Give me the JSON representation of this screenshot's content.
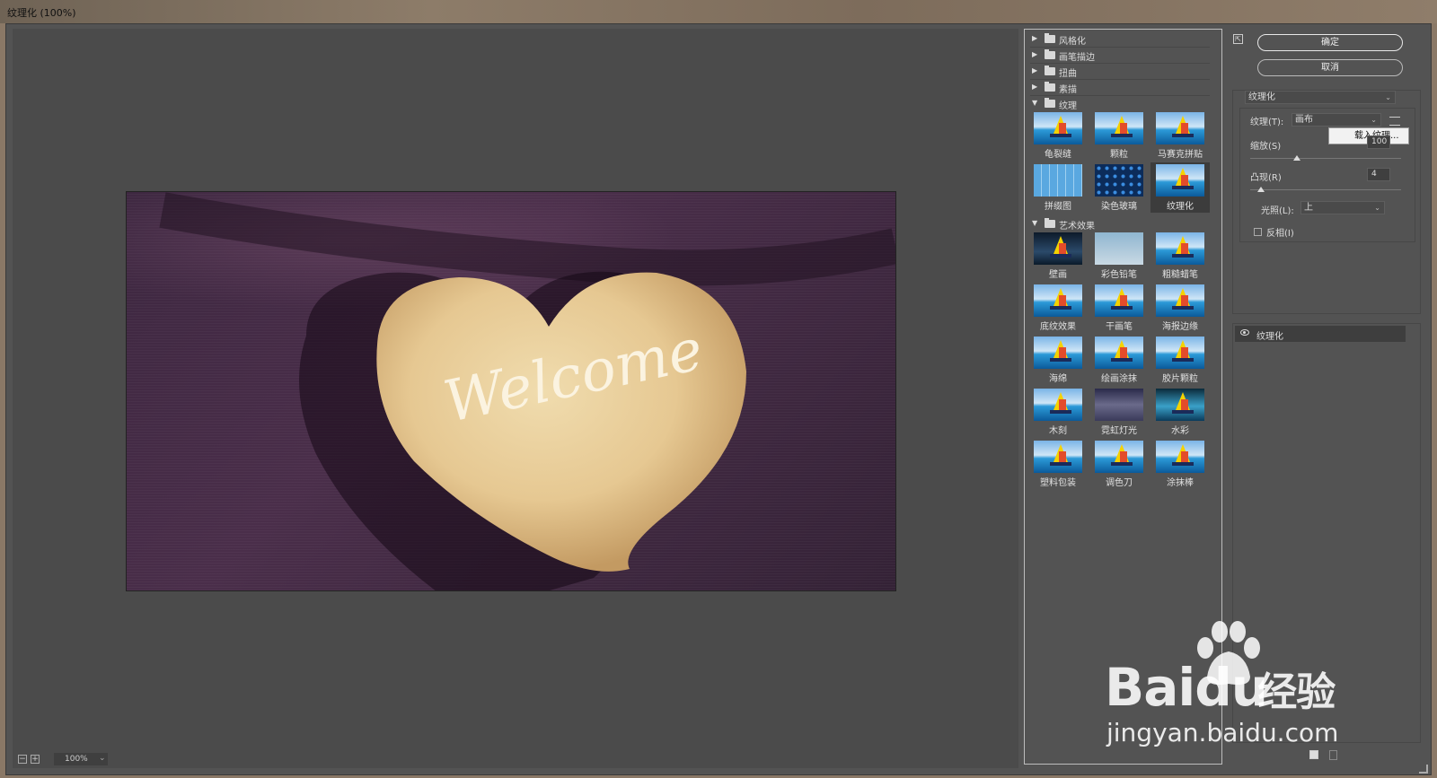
{
  "window": {
    "title": "纹理化 (100%)"
  },
  "preview": {
    "zoom": "100%",
    "photo_text": "Welcome"
  },
  "filter_gallery": {
    "categories": [
      {
        "label": "风格化",
        "expanded": false
      },
      {
        "label": "画笔描边",
        "expanded": false
      },
      {
        "label": "扭曲",
        "expanded": false
      },
      {
        "label": "素描",
        "expanded": false
      },
      {
        "label": "纹理",
        "expanded": true,
        "items": [
          "龟裂缝",
          "颗粒",
          "马赛克拼贴",
          "拼缀图",
          "染色玻璃",
          "纹理化"
        ],
        "selected": "纹理化"
      },
      {
        "label": "艺术效果",
        "expanded": true,
        "items": [
          "壁画",
          "彩色铅笔",
          "粗糙蜡笔",
          "底纹效果",
          "干画笔",
          "海报边缘",
          "海绵",
          "绘画涂抹",
          "胶片颗粒",
          "木刻",
          "霓虹灯光",
          "水彩",
          "塑料包装",
          "调色刀",
          "涂抹棒"
        ]
      }
    ]
  },
  "controls": {
    "ok_label": "确定",
    "cancel_label": "取消",
    "filter_select": "纹理化",
    "texture_label": "纹理(T):",
    "texture_value": "画布",
    "load_texture": "载入纹理...",
    "scaling_label": "缩放(S)",
    "scaling_value": 100,
    "relief_label": "凸现(R)",
    "relief_value": "4",
    "relief_max": 50,
    "light_label": "光照(L):",
    "light_value": "上",
    "invert_label": "反相(I)",
    "invert_checked": false
  },
  "layers": {
    "items": [
      {
        "label": "纹理化",
        "visible": true
      }
    ]
  },
  "watermark": {
    "brand": "Bai",
    "brand_du": "du",
    "brand_cn": "经验",
    "url": "jingyan.baidu.com"
  },
  "colors": {
    "dialog_bg": "#535353",
    "canvas_bg": "#4b4b4b",
    "photo_bg": "#3d2740",
    "stone": "#e8cf9c"
  }
}
